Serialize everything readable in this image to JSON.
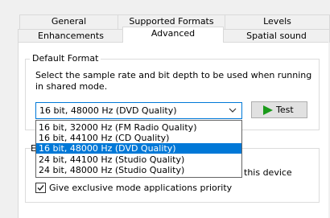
{
  "tabs": {
    "row1": [
      "General",
      "Supported Formats",
      "Levels"
    ],
    "row2": [
      "Enhancements",
      "Advanced",
      "Spatial sound"
    ],
    "active": "Advanced"
  },
  "default_format": {
    "title": "Default Format",
    "description_line1": "Select the sample rate and bit depth to be used when running",
    "description_line2": "in shared mode.",
    "selected_value": "16 bit, 48000 Hz (DVD Quality)",
    "test_label": "Test",
    "options": [
      "16 bit, 32000 Hz (FM Radio Quality)",
      "16 bit, 44100 Hz (CD Quality)",
      "16 bit, 48000 Hz (DVD Quality)",
      "24 bit, 44100 Hz (Studio Quality)",
      "24 bit, 48000 Hz (Studio Quality)"
    ],
    "selected_index": 2
  },
  "exclusive_mode": {
    "partial_title_letter": "E",
    "partial_option_text": "this device",
    "priority_label": "Give exclusive mode applications priority",
    "priority_checked": true
  },
  "colors": {
    "accent": "#0078d7",
    "play_icon": "#1a9a1a"
  },
  "icons": {
    "dropdown_arrow": "chevron-down-icon",
    "test_play": "play-icon",
    "checkmark": "check-icon"
  }
}
